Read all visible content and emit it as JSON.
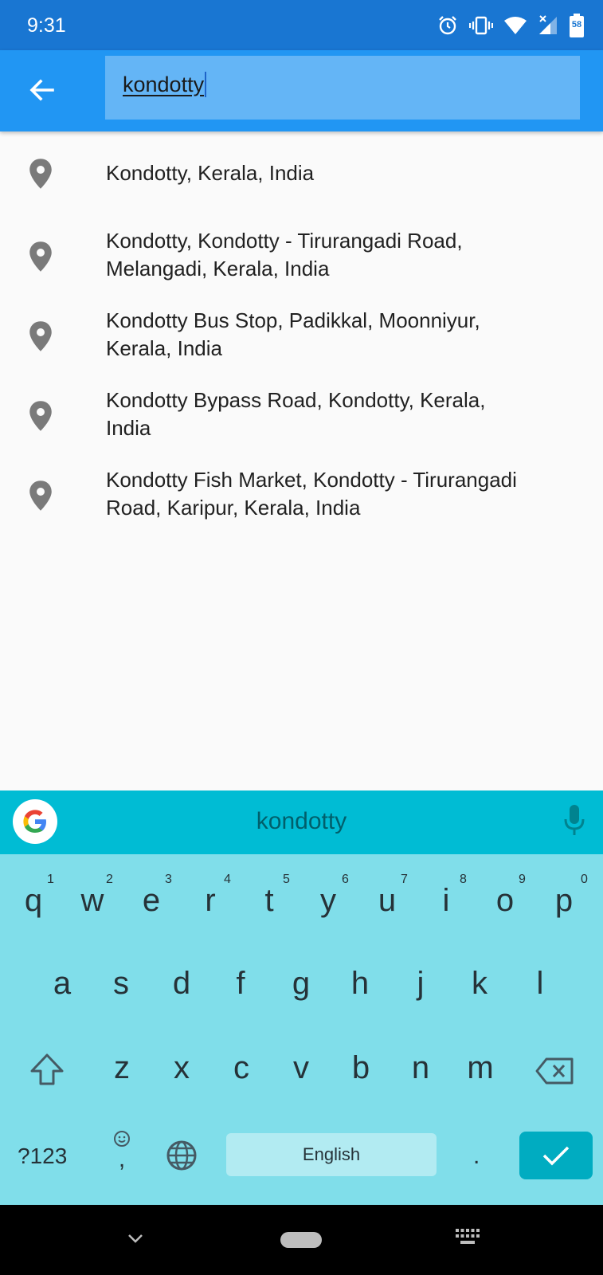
{
  "status_bar": {
    "time": "9:31",
    "battery_level": "58",
    "icons": [
      "alarm-icon",
      "vibrate-icon",
      "wifi-icon",
      "signal-icon",
      "battery-icon"
    ]
  },
  "app_bar": {
    "back_icon": "arrow-back-icon",
    "search_value": "kondotty",
    "background_color": "#2196f3",
    "search_box_color": "#64b5f6"
  },
  "results": [
    {
      "icon": "location-pin-icon",
      "label": "Kondotty, Kerala, India"
    },
    {
      "icon": "location-pin-icon",
      "line1": "Kondotty, Kondotty - Tirurangadi Road,",
      "line2": "Melangadi, Kerala, India"
    },
    {
      "icon": "location-pin-icon",
      "line1": "Kondotty Bus Stop, Padikkal, Moonniyur,",
      "line2": "Kerala, India"
    },
    {
      "icon": "location-pin-icon",
      "line1": "Kondotty Bypass Road, Kondotty, Kerala,",
      "line2": "India"
    },
    {
      "icon": "location-pin-icon",
      "line1": "Kondotty Fish Market, Kondotty - Tirurangadi",
      "line2": "Road, Karipur, Kerala, India"
    }
  ],
  "keyboard": {
    "suggestion": "kondotty",
    "row1": [
      "q",
      "w",
      "e",
      "r",
      "t",
      "y",
      "u",
      "i",
      "o",
      "p"
    ],
    "row1_hints": [
      "1",
      "2",
      "3",
      "4",
      "5",
      "6",
      "7",
      "8",
      "9",
      "0"
    ],
    "row2": [
      "a",
      "s",
      "d",
      "f",
      "g",
      "h",
      "j",
      "k",
      "l"
    ],
    "row3": [
      "z",
      "x",
      "c",
      "v",
      "b",
      "n",
      "m"
    ],
    "symbols_label": "?123",
    "comma": ",",
    "period": ".",
    "space_label": "English",
    "colors": {
      "suggest_bar": "#00bcd4",
      "keys_bg": "#80deea",
      "enter": "#00acc1"
    }
  },
  "nav_bar": {
    "icons": [
      "nav-back-icon",
      "nav-home-pill",
      "keyboard-switch-icon"
    ]
  }
}
